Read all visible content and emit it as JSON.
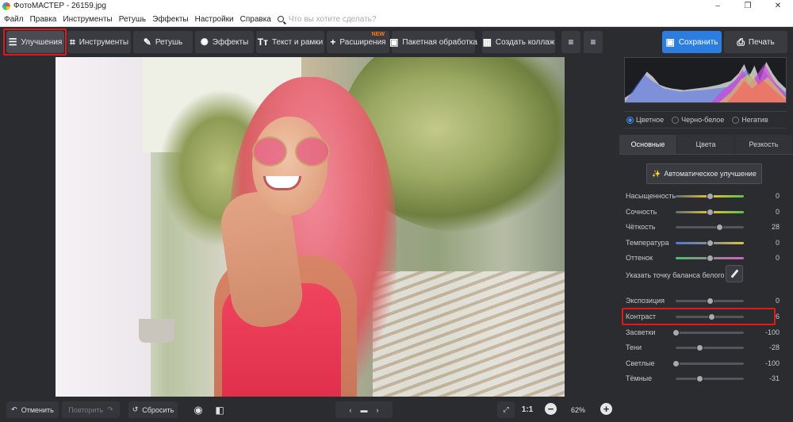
{
  "window": {
    "title": "ФотоМАСТЕР - 26159.jpg",
    "controls": [
      "–",
      "❐",
      "✕"
    ]
  },
  "menu": {
    "items": [
      "Файл",
      "Правка",
      "Инструменты",
      "Ретушь",
      "Эффекты",
      "Настройки",
      "Справка"
    ],
    "search_placeholder": "Что вы хотите сделать?"
  },
  "toolbar": {
    "tabs": [
      {
        "label": "Улучшения",
        "icon": "sliders-icon",
        "glyph": "☰"
      },
      {
        "label": "Инструменты",
        "icon": "crop-icon",
        "glyph": "⌗"
      },
      {
        "label": "Ретушь",
        "icon": "brush-icon",
        "glyph": "✎"
      },
      {
        "label": "Эффекты",
        "icon": "sparkle-icon",
        "glyph": "✺"
      },
      {
        "label": "Текст и рамки",
        "icon": "text-icon",
        "glyph": "Tт"
      },
      {
        "label": "Расширения",
        "icon": "plus-icon",
        "glyph": "+",
        "badge": "NEW"
      },
      {
        "label": "Пакетная обработка",
        "icon": "batch-icon",
        "glyph": "▣"
      },
      {
        "label": "Создать коллаж",
        "icon": "collage-icon",
        "glyph": "▦"
      }
    ],
    "save_label": "Сохранить",
    "print_label": "Печать",
    "highlight_color": "#e0191c"
  },
  "right_panel": {
    "color_modes": [
      {
        "label": "Цветное",
        "selected": true
      },
      {
        "label": "Черно-белое",
        "selected": false
      },
      {
        "label": "Негатив",
        "selected": false
      }
    ],
    "tabs": [
      "Основные",
      "Цвета",
      "Резкость"
    ],
    "auto_button": "Автоматическое улучшение",
    "white_balance_label": "Указать точку баланса белого",
    "sliders": [
      {
        "label": "Насыщенность",
        "value": "0",
        "level": 0.5
      },
      {
        "label": "Сочность",
        "value": "0",
        "level": 0.5
      },
      {
        "label": "Чёткость",
        "value": "28",
        "level": 0.64
      },
      {
        "label": "Температура",
        "value": "0",
        "level": 0.5
      },
      {
        "label": "Оттенок",
        "value": "0",
        "level": 0.5
      },
      {
        "label": "Экспозиция",
        "value": "0",
        "level": 0.5
      },
      {
        "label": "Контраст",
        "value": "6",
        "level": 0.53
      },
      {
        "label": "Засветки",
        "value": "-100",
        "level": 0.0
      },
      {
        "label": "Тени",
        "value": "-28",
        "level": 0.36
      },
      {
        "label": "Светлые",
        "value": "-100",
        "level": 0.0
      },
      {
        "label": "Тёмные",
        "value": "-31",
        "level": 0.35
      }
    ]
  },
  "bottom": {
    "undo_label": "Отменить",
    "redo_label": "Повторить",
    "reset_label": "Сбросить",
    "ratio_label": "1:1",
    "zoom": "62%"
  }
}
